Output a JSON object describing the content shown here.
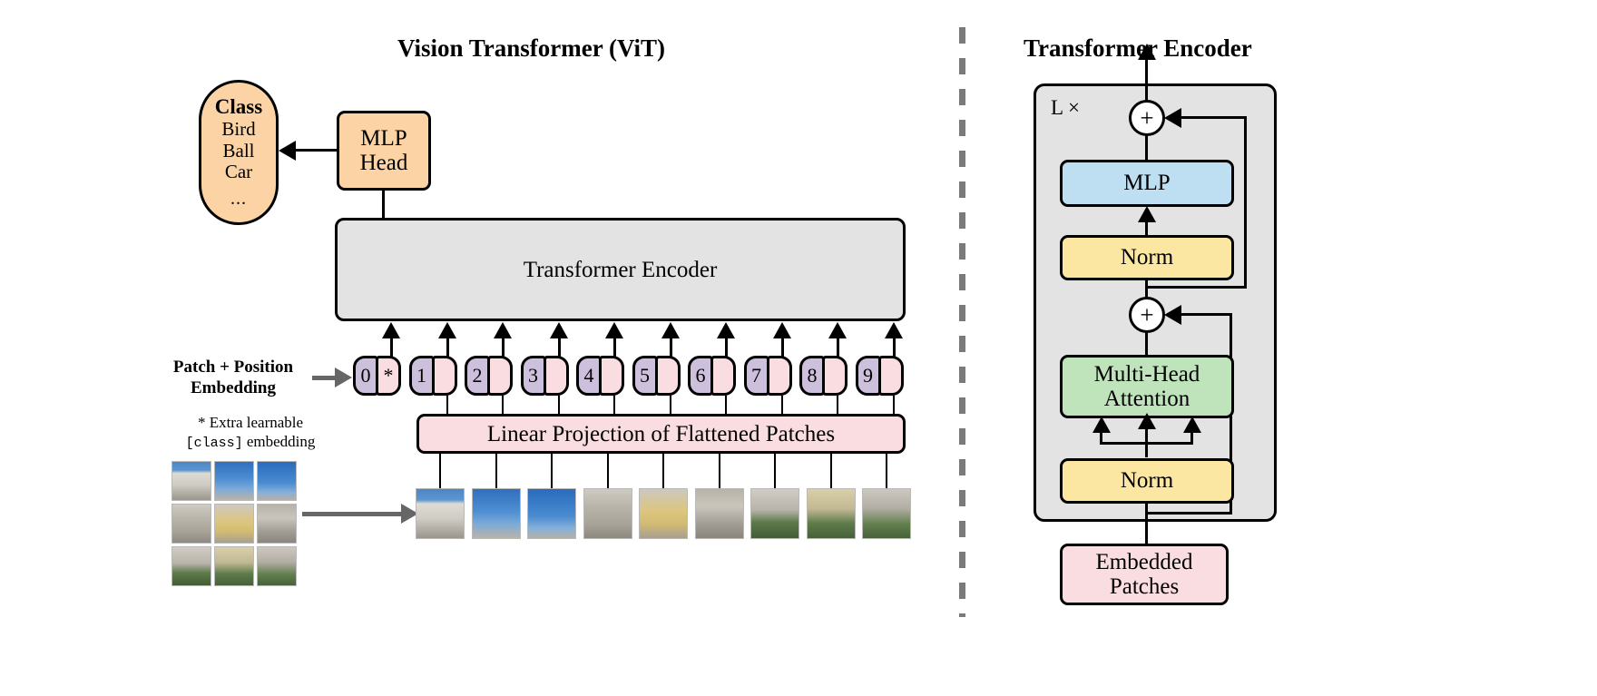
{
  "left_panel": {
    "title": "Vision Transformer (ViT)",
    "class_pill": {
      "header": "Class",
      "items": [
        "Bird",
        "Ball",
        "Car"
      ],
      "ellipsis": "..."
    },
    "mlp_head": {
      "line1": "MLP",
      "line2": "Head"
    },
    "transformer_encoder": "Transformer Encoder",
    "linear_projection": "Linear Projection of Flattened Patches",
    "patch_position_label": {
      "line1": "Patch + Position",
      "line2": "Embedding"
    },
    "extra_note": {
      "line1": "* Extra learnable",
      "mono": "[class]",
      "line2_tail": " embedding"
    },
    "tokens": [
      {
        "pos": "0",
        "patch": "*"
      },
      {
        "pos": "1",
        "patch": ""
      },
      {
        "pos": "2",
        "patch": ""
      },
      {
        "pos": "3",
        "patch": ""
      },
      {
        "pos": "4",
        "patch": ""
      },
      {
        "pos": "5",
        "patch": ""
      },
      {
        "pos": "6",
        "patch": ""
      },
      {
        "pos": "7",
        "patch": ""
      },
      {
        "pos": "8",
        "patch": ""
      },
      {
        "pos": "9",
        "patch": ""
      }
    ],
    "source_image_grid_rows": 3,
    "source_image_grid_cols": 3,
    "patch_strip_count": 9
  },
  "right_panel": {
    "title": "Transformer Encoder",
    "repeat_label": "L ×",
    "add_symbol": "+",
    "blocks": {
      "mlp": "MLP",
      "norm_top": "Norm",
      "multi_head_attention": {
        "line1": "Multi-Head",
        "line2": "Attention"
      },
      "norm_bottom": "Norm",
      "embedded_patches": {
        "line1": "Embedded",
        "line2": "Patches"
      }
    }
  },
  "colors": {
    "orange": "#fbd3a4",
    "gray_box": "#e3e3e3",
    "pink": "#fadde1",
    "purple": "#cdc0dd",
    "blue": "#bedff2",
    "yellow": "#fbe6a2",
    "green": "#bfe3bb",
    "stroke": "#000000",
    "divider": "#7a7a7a"
  }
}
